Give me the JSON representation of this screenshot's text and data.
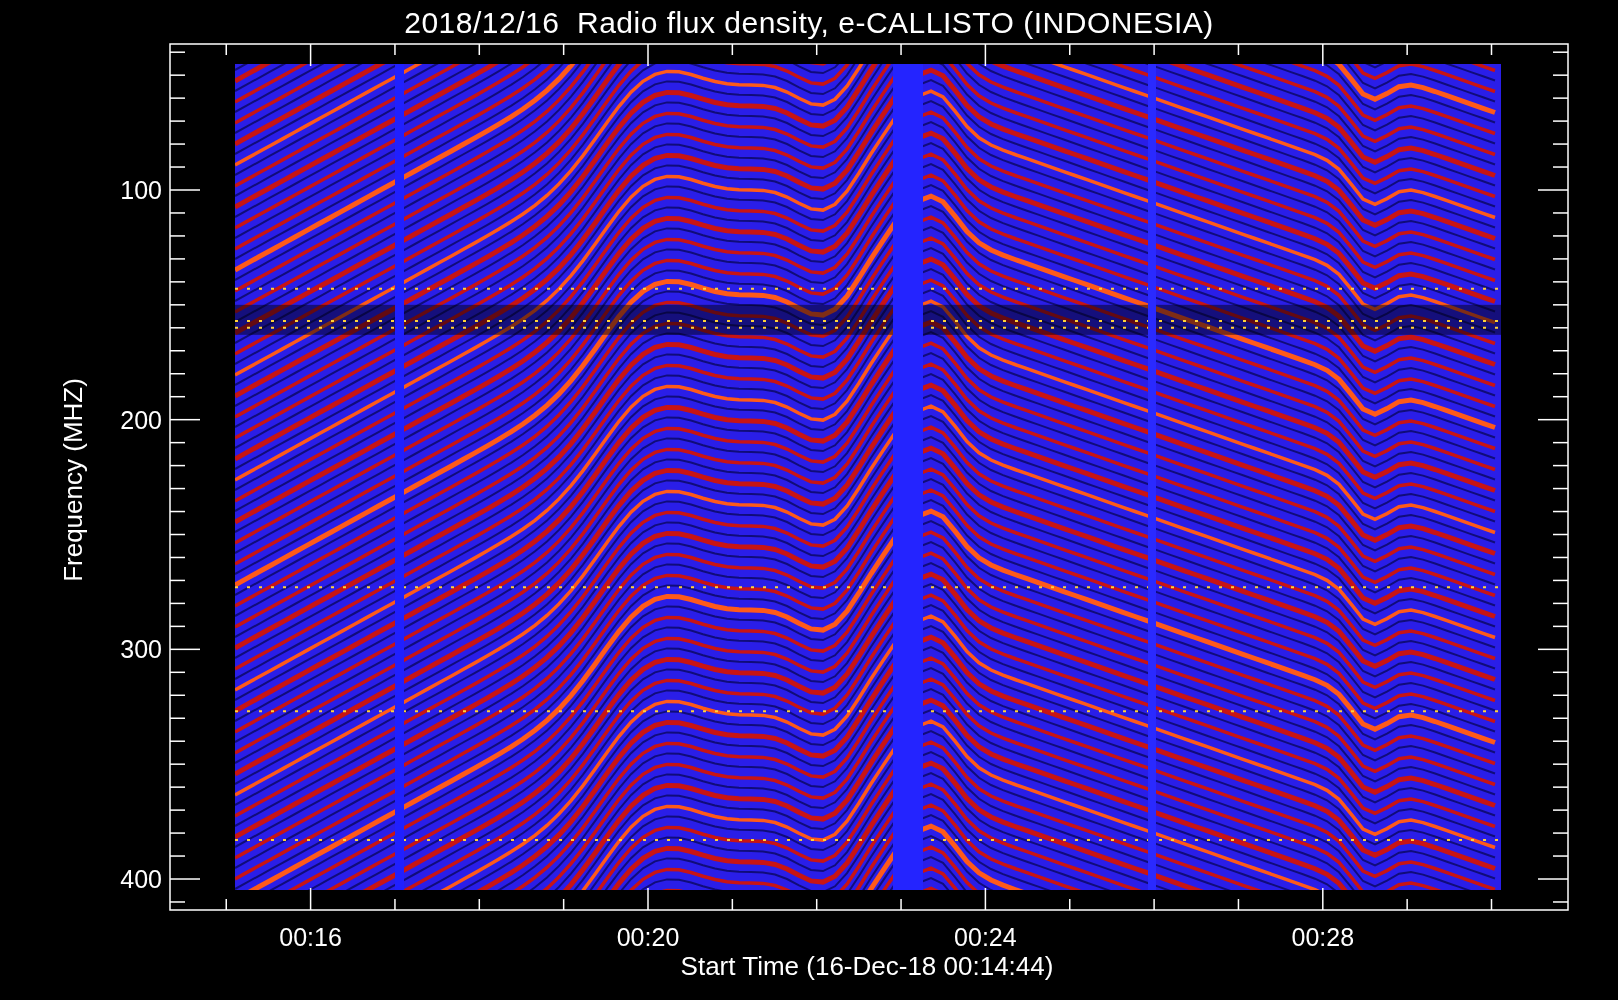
{
  "title": "2018/12/16  Radio flux density, e-CALLISTO (INDONESIA)",
  "plot": {
    "ylabel": "Frequency (MHZ)",
    "xlabel": "Start Time (16-Dec-18 00:14:44)",
    "yticks": [
      "100",
      "200",
      "300",
      "400"
    ],
    "xticks": [
      "00:16",
      "00:20",
      "00:24",
      "00:28"
    ]
  }
}
